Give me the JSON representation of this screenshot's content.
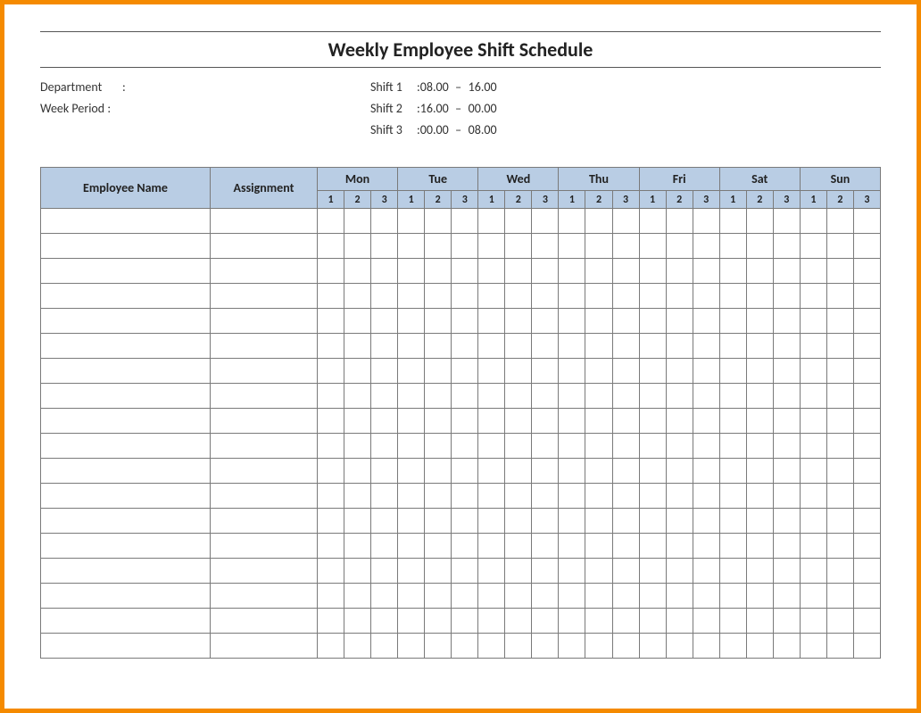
{
  "title": "Weekly Employee Shift Schedule",
  "meta": {
    "department_label": "Department",
    "department_value": "",
    "week_period_label": "Week  Period :",
    "week_period_value": "",
    "shift_defs": [
      {
        "label": "Shift 1",
        "from": "08.00",
        "to": "16.00"
      },
      {
        "label": "Shift 2",
        "from": "16.00",
        "to": "00.00"
      },
      {
        "label": "Shift 3",
        "from": "00.00",
        "to": "08.00"
      }
    ]
  },
  "table": {
    "employee_header": "Employee Name",
    "assignment_header": "Assignment",
    "days": [
      "Mon",
      "Tue",
      "Wed",
      "Thu",
      "Fri",
      "Sat",
      "Sun"
    ],
    "shift_nums": [
      "1",
      "2",
      "3"
    ],
    "row_count": 18
  }
}
